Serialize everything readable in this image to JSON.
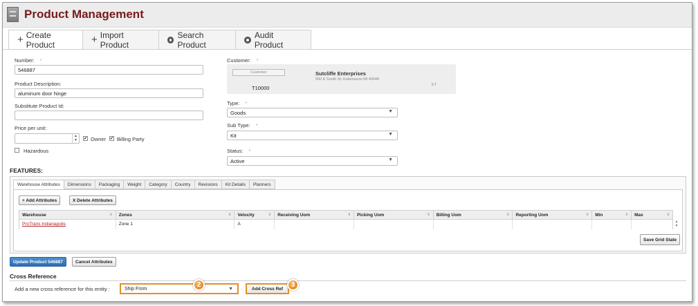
{
  "header": {
    "title": "Product Management"
  },
  "tabs": [
    {
      "label": "Create Product",
      "icon": "plus-icon"
    },
    {
      "label": "Import Product",
      "icon": "plus-icon"
    },
    {
      "label": "Search Product",
      "icon": "search-circle-icon"
    },
    {
      "label": "Audit Product",
      "icon": "audit-circle-icon"
    }
  ],
  "form": {
    "number_label": "Number:",
    "number_value": "546887",
    "description_label": "Product Description:",
    "description_value": "aluminum door hinge",
    "substitute_label": "Substitute Product Id:",
    "substitute_value": "",
    "price_label": "Price per unit:",
    "price_value": "",
    "owner_label": "Owner",
    "billing_label": "Billing Party",
    "hazardous_label": "Hazardous",
    "customer_label": "Customer:",
    "customer_badge": "Customer",
    "customer_id": "T10000",
    "customer_name": "Sutcliffe Enterprises",
    "customer_address": "500 E South St, Kalamazoo MI 49048",
    "customer_tz": "ET",
    "type_label": "Type:",
    "type_value": "Goods",
    "subtype_label": "Sub Type:",
    "subtype_value": "Kit",
    "status_label": "Status:",
    "status_value": "Active",
    "required_marker": "*"
  },
  "features": {
    "title": "FEATURES:",
    "tabs": [
      "Warehouse Attributes",
      "Dimensions",
      "Packaging",
      "Weight",
      "Category",
      "Country",
      "Revisions",
      "Kit Details",
      "Planners"
    ],
    "add_button": "+ Add Attributes",
    "delete_button": "X Delete Attributes",
    "columns": [
      "Warehouse",
      "Zones",
      "Velocity",
      "Receiving Uom",
      "Picking Uom",
      "Billing Uom",
      "Reporting Uom",
      "Min",
      "Max"
    ],
    "rows": [
      {
        "warehouse": "ProTrans Indianapolis",
        "zones": "Zone 1",
        "velocity": "A",
        "receiving": "",
        "picking": "",
        "billing": "",
        "reporting": "",
        "min": "",
        "max": ""
      }
    ],
    "save_grid": "Save Grid State"
  },
  "actions": {
    "update": "Update Product 546887",
    "cancel": "Cancel Attributes"
  },
  "cross_reference": {
    "title": "Cross Reference",
    "prompt": "Add a new cross reference for this entity :",
    "select_value": "Ship From",
    "add_button": "Add Cross Ref",
    "callout_select": "2",
    "callout_button": "3"
  },
  "colors": {
    "title": "#7a1a1a",
    "highlight": "#e0902a",
    "callout": "#e07a12",
    "primary_button": "#2e6db0"
  }
}
